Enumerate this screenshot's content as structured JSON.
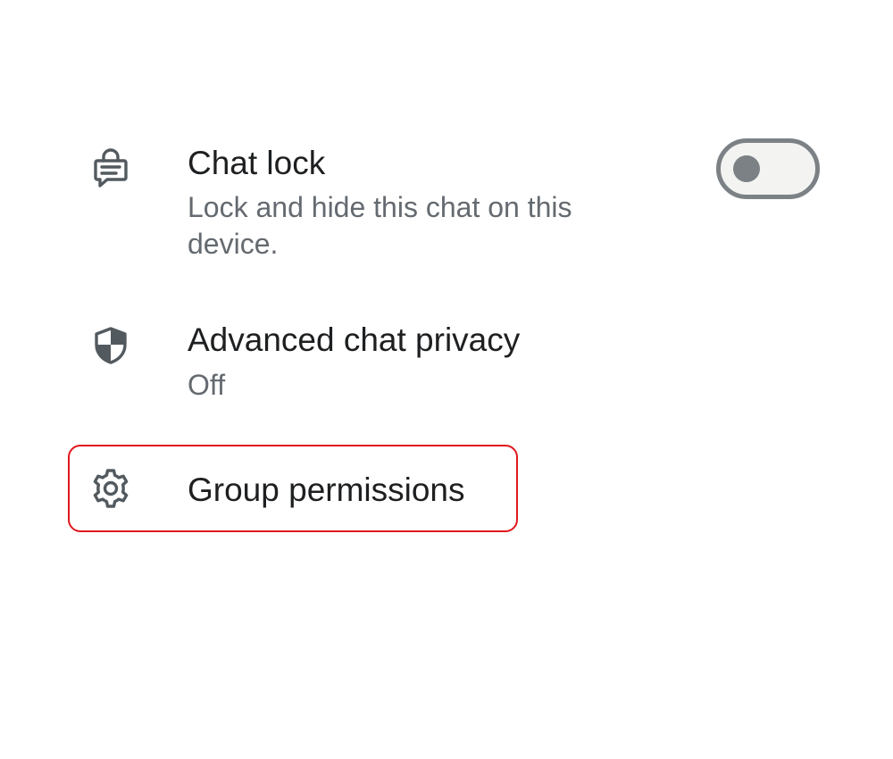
{
  "settings": {
    "chat_lock": {
      "icon": "chat-lock-icon",
      "title": "Chat lock",
      "subtitle": "Lock and hide this chat on this device.",
      "toggle_on": false
    },
    "advanced_privacy": {
      "icon": "shield-icon",
      "title": "Advanced chat privacy",
      "status": "Off"
    },
    "group_permissions": {
      "icon": "gear-icon",
      "title": "Group permissions"
    }
  },
  "colors": {
    "title_text": "#1d1f21",
    "subtitle_text": "#646a70",
    "icon": "#535a5f",
    "toggle_track": "#f3f3f1",
    "toggle_outline": "#7b8185",
    "highlight_border": "#e0181c"
  }
}
